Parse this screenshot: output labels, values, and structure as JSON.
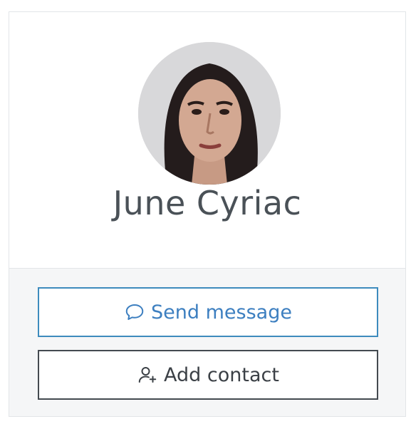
{
  "profile": {
    "name": "June Cyriac",
    "avatar_icon": "user-photo"
  },
  "actions": {
    "send_message": {
      "label": "Send message",
      "icon": "chat-bubble-icon"
    },
    "add_contact": {
      "label": "Add contact",
      "icon": "add-user-icon"
    }
  },
  "colors": {
    "primary": "#3d7fc0",
    "text_dark": "#4a5157",
    "border": "#e2e5e8",
    "footer_bg": "#f5f6f7"
  }
}
